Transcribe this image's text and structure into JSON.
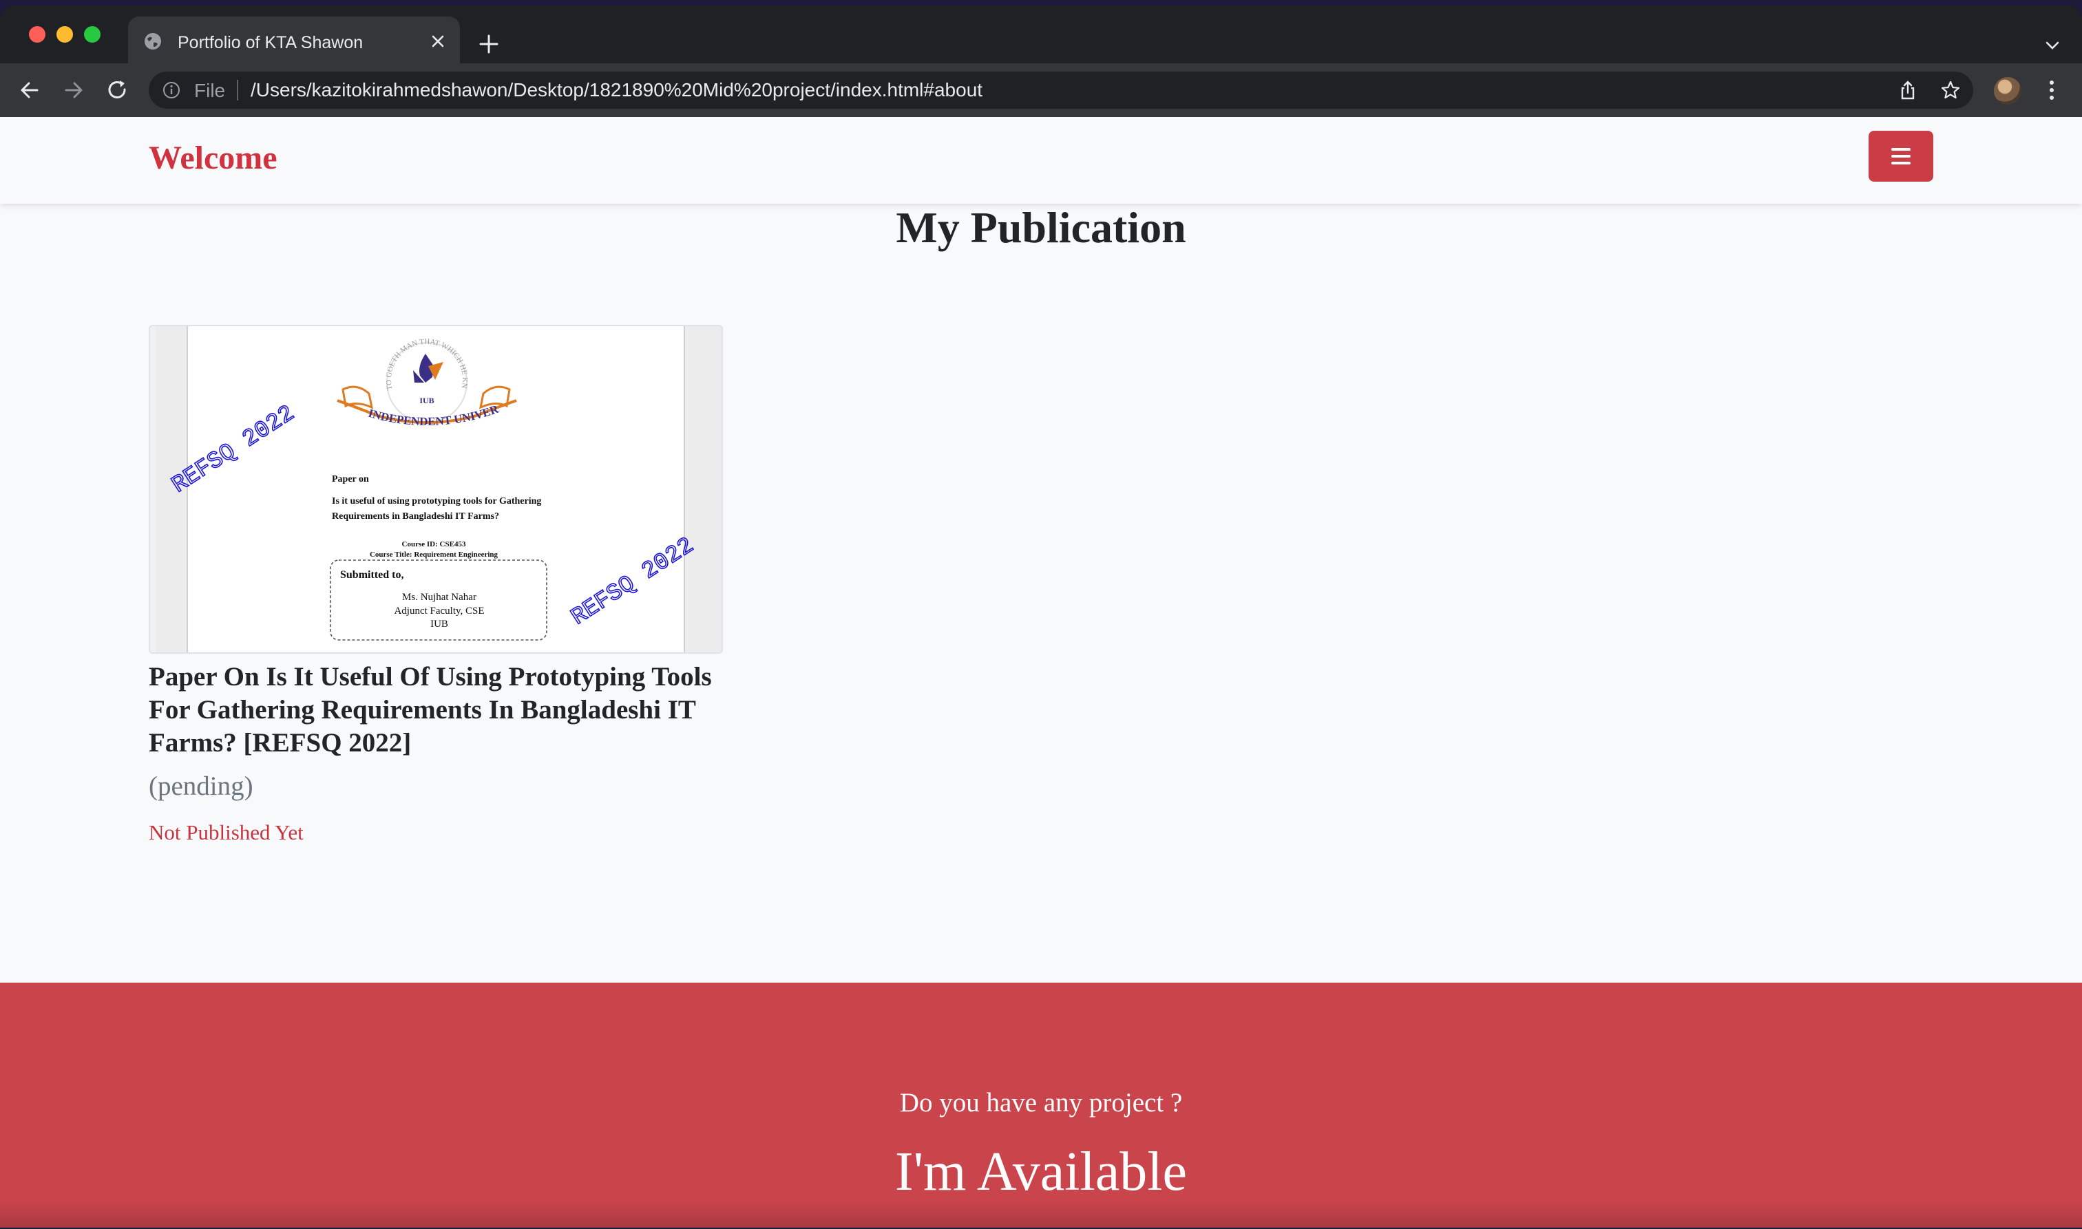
{
  "browser": {
    "tab_title": "Portfolio of KTA Shawon",
    "url_scheme": "File",
    "url": "/Users/kazitokirahmedshawon/Desktop/1821890%20Mid%20project/index.html#about"
  },
  "navbar": {
    "brand": "Welcome",
    "menu_icon": "hamburger-menu-icon",
    "accent_color": "#ca3d47"
  },
  "section": {
    "title": "My Publication"
  },
  "publication": {
    "thumbnail": {
      "university_name": "INDEPENDENT UNIVERSITY",
      "logo_text": "IUB",
      "motto": "TO GOETH MAN THAT WHICH HE KNEW NOT",
      "watermark": "REFSQ 2022",
      "heading": "Paper on",
      "subject_line1": "Is it useful of using prototyping tools for Gathering",
      "subject_line2": "Requirements in Bangladeshi IT Farms?",
      "course_id": "Course ID: CSE453",
      "course_title": "Course Title: Requirement Engineering",
      "submitted_label": "Submitted to,",
      "faculty_name": "Ms. Nujhat Nahar",
      "faculty_role": "Adjunct Faculty, CSE",
      "faculty_institution": "IUB"
    },
    "title": "Paper On Is It Useful Of Using Prototyping Tools For Gathering Requirements In Bangladeshi IT Farms? [REFSQ 2022]",
    "status": "(pending)",
    "note": "Not Published Yet"
  },
  "footer": {
    "question": "Do you have any project ?",
    "cta": "I'm Available",
    "background_color": "#ca444c"
  }
}
